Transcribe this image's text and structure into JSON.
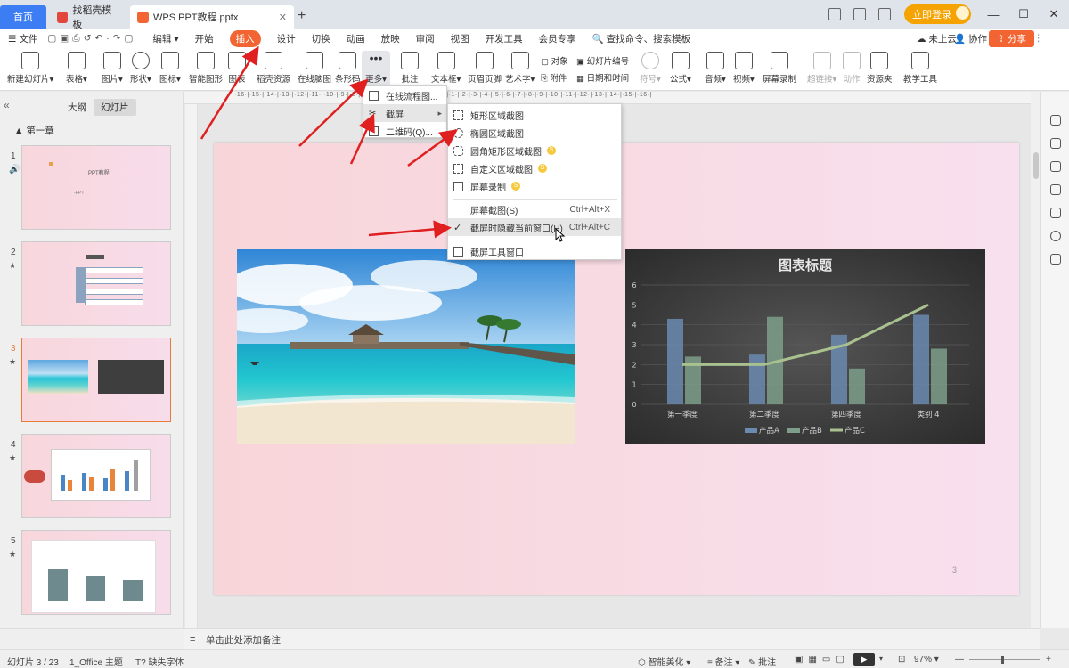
{
  "titlebar": {
    "tabs": [
      {
        "label": "首页"
      },
      {
        "label": "找稻壳模板"
      },
      {
        "label": "WPS PPT教程.pptx"
      }
    ],
    "login": "立即登录"
  },
  "menu": {
    "items": [
      "文件",
      "编辑",
      "开始",
      "插入",
      "设计",
      "切换",
      "动画",
      "放映",
      "审阅",
      "视图",
      "开发工具",
      "会员专享"
    ],
    "search_placeholder": "查找命令、搜索模板",
    "cloud": "未上云",
    "collab": "协作",
    "share": "分享"
  },
  "ribbon": {
    "buttons": [
      "新建幻灯片",
      "表格",
      "图片",
      "形状",
      "图标",
      "智能图形",
      "图表",
      "稻壳资源",
      "在线脑图",
      "条形码",
      "更多",
      "批注",
      "文本框",
      "页眉页脚",
      "艺术字",
      "音频",
      "视频",
      "屏幕录制",
      "超链接",
      "动作",
      "资源夹",
      "教学工具",
      "符号",
      "公式"
    ],
    "small": [
      "对象",
      "附件",
      "幻灯片编号",
      "日期和时间"
    ]
  },
  "left": {
    "tab_outline": "大纲",
    "tab_slides": "幻灯片",
    "chapter": "第一章",
    "numbers": [
      "1",
      "2",
      "3",
      "4",
      "5"
    ],
    "slide1_title": "PPT教程",
    "slide1_sub": "-PPT"
  },
  "menu1": {
    "items": [
      "在线流程图...",
      "截屏",
      "二维码(Q)..."
    ]
  },
  "menu2": {
    "items": [
      {
        "label": "矩形区域截图",
        "shortcut": ""
      },
      {
        "label": "椭圆区域截图",
        "shortcut": ""
      },
      {
        "label": "圆角矩形区域截图",
        "shortcut": ""
      },
      {
        "label": "自定义区域截图",
        "shortcut": ""
      },
      {
        "label": "屏幕录制",
        "shortcut": ""
      },
      {
        "label": "屏幕截图(S)",
        "shortcut": "Ctrl+Alt+X"
      },
      {
        "label": "截屏时隐藏当前窗口(H)",
        "shortcut": "Ctrl+Alt+C"
      },
      {
        "label": "截屏工具窗口",
        "shortcut": ""
      }
    ],
    "badge": "S"
  },
  "slide": {
    "page_number": "3"
  },
  "chart_data": {
    "type": "bar",
    "title": "图表标题",
    "categories": [
      "第一季度",
      "第二季度",
      "第四季度",
      "类别 4"
    ],
    "series": [
      {
        "name": "产品A",
        "type": "bar",
        "values": [
          4.3,
          2.5,
          3.5,
          4.5
        ],
        "color": "#6b8ab0"
      },
      {
        "name": "产品B",
        "type": "bar",
        "values": [
          2.4,
          4.4,
          1.8,
          2.8
        ],
        "color": "#7d9e8a"
      },
      {
        "name": "产品C",
        "type": "line",
        "values": [
          2.0,
          2.0,
          3.0,
          5.0
        ],
        "color": "#a9c08f"
      }
    ],
    "ylim": [
      0,
      6
    ],
    "yticks": [
      "0",
      "1",
      "2",
      "3",
      "4",
      "5",
      "6"
    ]
  },
  "notes": {
    "placeholder": "单击此处添加备注"
  },
  "status": {
    "slide": "幻灯片 3 / 23",
    "theme": "1_Office 主题",
    "font": "缺失字体",
    "beautify": "智能美化",
    "notes": "备注",
    "comment": "批注",
    "zoom": "97%"
  }
}
